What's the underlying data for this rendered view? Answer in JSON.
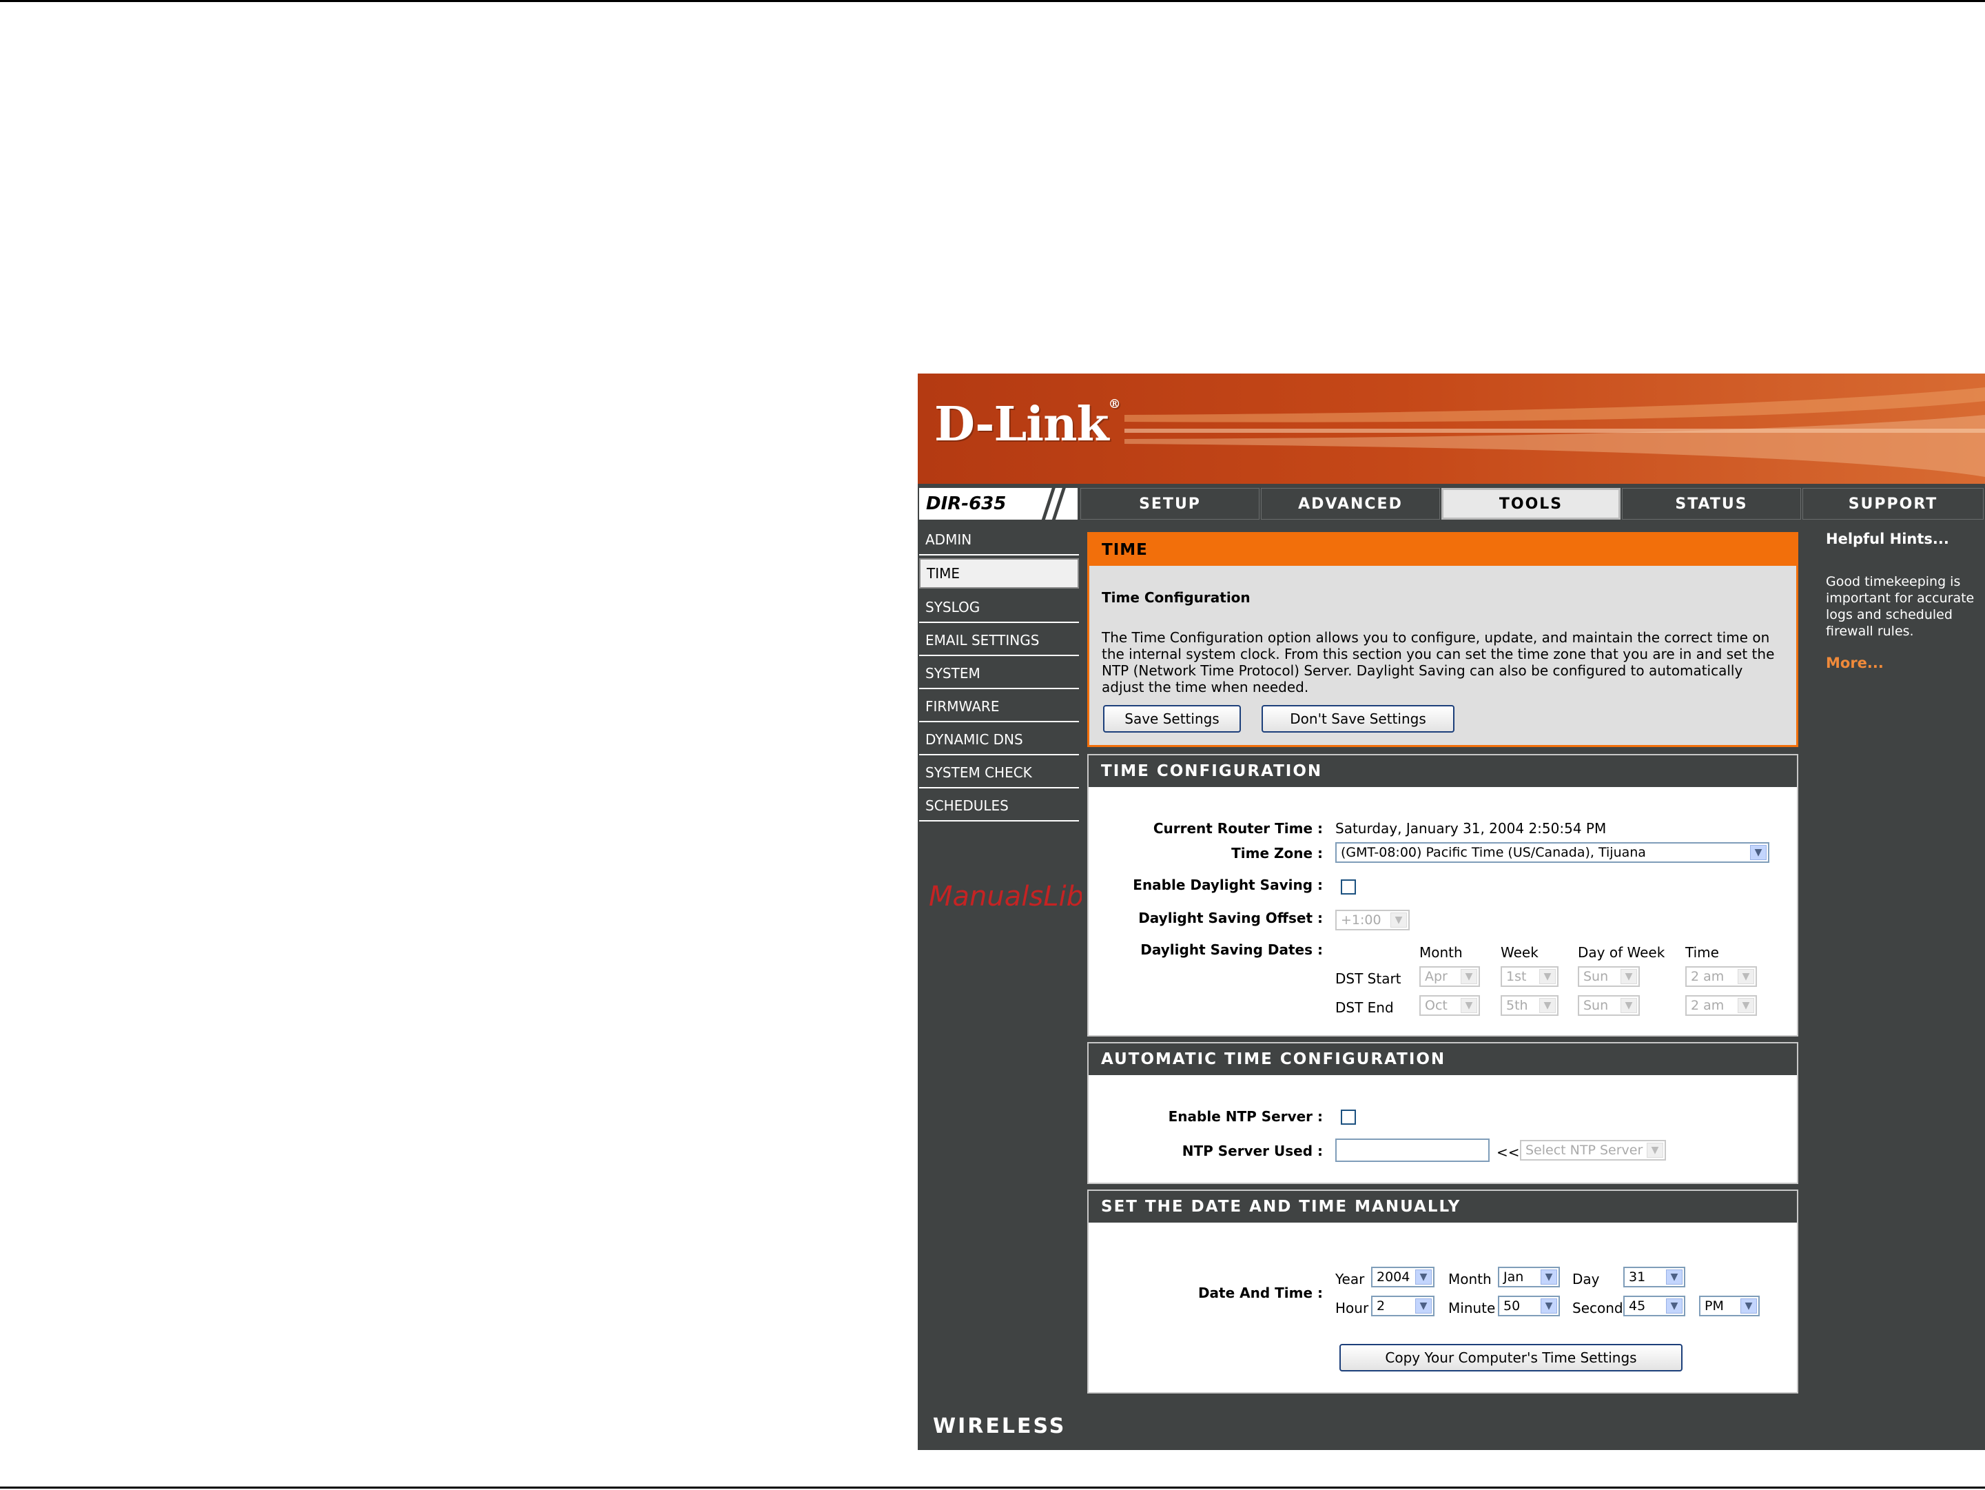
{
  "brand": {
    "logo": "D-Link",
    "model": "DIR-635",
    "footer": "WIRELESS"
  },
  "tabs": [
    "SETUP",
    "ADVANCED",
    "TOOLS",
    "STATUS",
    "SUPPORT"
  ],
  "active_tab": "TOOLS",
  "sidebar": [
    "ADMIN",
    "TIME",
    "SYSLOG",
    "EMAIL SETTINGS",
    "SYSTEM",
    "FIRMWARE",
    "DYNAMIC DNS",
    "SYSTEM CHECK",
    "SCHEDULES"
  ],
  "active_sidebar": "TIME",
  "watermark": "ManualsLib.ru",
  "intro": {
    "header": "TIME",
    "subtitle": "Time Configuration",
    "description": "The Time Configuration option allows you to configure, update, and maintain the correct time on the internal system clock. From this section you can set the time zone that you are in and set the NTP (Network Time Protocol) Server. Daylight Saving can also be configured to automatically adjust the time when needed.",
    "save_label": "Save Settings",
    "dont_save_label": "Don't Save Settings"
  },
  "time_config": {
    "header": "TIME CONFIGURATION",
    "current_time_label": "Current Router Time :",
    "current_time_value": "Saturday, January 31, 2004 2:50:54 PM",
    "time_zone_label": "Time Zone :",
    "time_zone_value": "(GMT-08:00) Pacific Time (US/Canada), Tijuana",
    "daylight_label": "Enable Daylight Saving :",
    "offset_label": "Daylight Saving Offset :",
    "offset_value": "+1:00",
    "dates_label": "Daylight Saving Dates :",
    "col_month": "Month",
    "col_week": "Week",
    "col_dow": "Day of Week",
    "col_time": "Time",
    "dst_start_label": "DST Start",
    "dst_end_label": "DST End",
    "dst_start": {
      "month": "Apr",
      "week": "1st",
      "dow": "Sun",
      "time": "2 am"
    },
    "dst_end": {
      "month": "Oct",
      "week": "5th",
      "dow": "Sun",
      "time": "2 am"
    }
  },
  "auto_time": {
    "header": "AUTOMATIC TIME CONFIGURATION",
    "ntp_enable_label": "Enable NTP Server :",
    "ntp_used_label": "NTP Server Used :",
    "arrow": "<<",
    "ntp_select": "Select NTP Server"
  },
  "manual": {
    "header": "SET THE DATE AND TIME MANUALLY",
    "label": "Date And Time :",
    "year_label": "Year",
    "year": "2004",
    "month_label": "Month",
    "month": "Jan",
    "day_label": "Day",
    "day": "31",
    "hour_label": "Hour",
    "hour": "2",
    "minute_label": "Minute",
    "minute": "50",
    "second_label": "Second",
    "second": "45",
    "ampm": "PM",
    "copy_label": "Copy Your Computer's Time Settings"
  },
  "hints": {
    "title": "Helpful Hints...",
    "text": "Good timekeeping is important for accurate logs and scheduled firewall rules.",
    "more": "More..."
  },
  "colors": {
    "orange": "#f26f0b",
    "dark": "#404343"
  }
}
